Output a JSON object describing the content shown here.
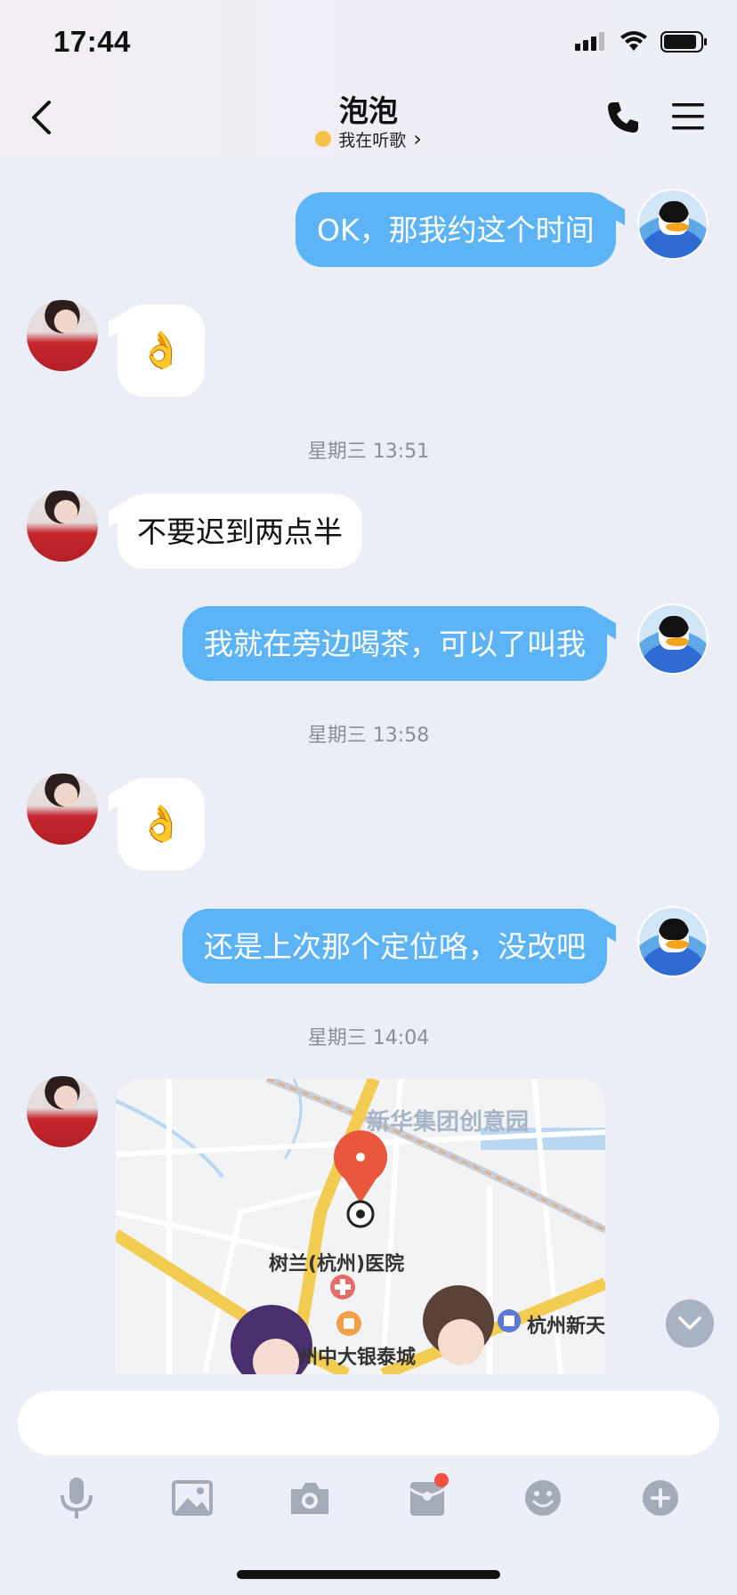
{
  "status_bar": {
    "time": "17:44"
  },
  "header": {
    "title": "泡泡",
    "status_text": "我在听歌",
    "status_arrow": "›"
  },
  "messages": [
    {
      "side": "me",
      "text": "OK，那我约这个时间"
    },
    {
      "side": "her",
      "text": "👌"
    },
    {
      "timestamp": "星期三 13:51"
    },
    {
      "side": "her",
      "text": "不要迟到两点半"
    },
    {
      "side": "me",
      "text": "我就在旁边喝茶，可以了叫我"
    },
    {
      "timestamp": "星期三 13:58"
    },
    {
      "side": "her",
      "text": "👌"
    },
    {
      "side": "me",
      "text": "还是上次那个定位咯，没改吧"
    },
    {
      "timestamp": "星期三 14:04"
    }
  ],
  "map": {
    "labels": [
      "新华集团创意园",
      "树兰(杭州)医院",
      "州中大银泰城",
      "杭州新天"
    ]
  },
  "colors": {
    "bubble_me": "#5cb4f7",
    "bubble_her": "#ffffff",
    "background": "#ebeef6",
    "badge": "#f2503f"
  },
  "icons": [
    "back-icon",
    "phone-icon",
    "menu-icon",
    "mic-icon",
    "image-icon",
    "camera-icon",
    "red-packet-icon",
    "emoji-icon",
    "plus-icon",
    "chevron-down-icon"
  ]
}
